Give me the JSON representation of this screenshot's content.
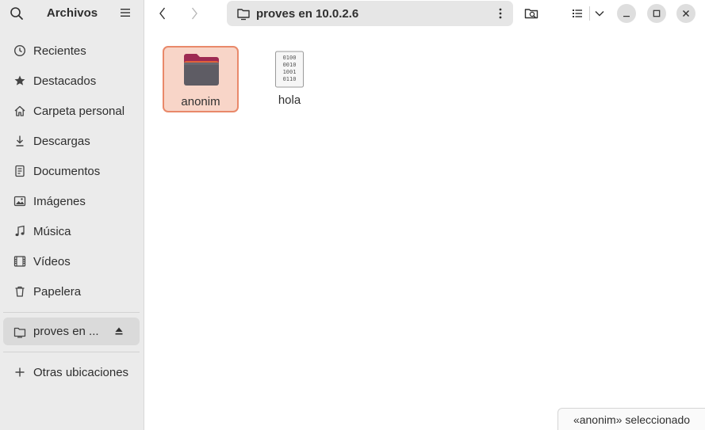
{
  "sidebar": {
    "title": "Archivos",
    "places": [
      {
        "label": "Recientes",
        "icon": "clock-icon"
      },
      {
        "label": "Destacados",
        "icon": "star-icon"
      },
      {
        "label": "Carpeta personal",
        "icon": "home-icon"
      },
      {
        "label": "Descargas",
        "icon": "download-icon"
      },
      {
        "label": "Documentos",
        "icon": "document-icon"
      },
      {
        "label": "Imágenes",
        "icon": "image-icon"
      },
      {
        "label": "Música",
        "icon": "music-icon"
      },
      {
        "label": "Vídeos",
        "icon": "video-icon"
      },
      {
        "label": "Papelera",
        "icon": "trash-icon"
      }
    ],
    "mount": {
      "label": "proves en ..."
    },
    "other_locations": "Otras ubicaciones"
  },
  "header": {
    "path": "proves en 10.0.2.6"
  },
  "files": [
    {
      "name": "anonim",
      "type": "folder",
      "selected": true
    },
    {
      "name": "hola",
      "type": "binary-file",
      "selected": false
    }
  ],
  "status": "«anonim» seleccionado",
  "colors": {
    "selection_bg": "#f8d5c8",
    "selection_border": "#e9896a",
    "folder_tab": "#9e2a52",
    "folder_body": "#5e5c64",
    "sidebar_bg": "#ebebeb"
  }
}
